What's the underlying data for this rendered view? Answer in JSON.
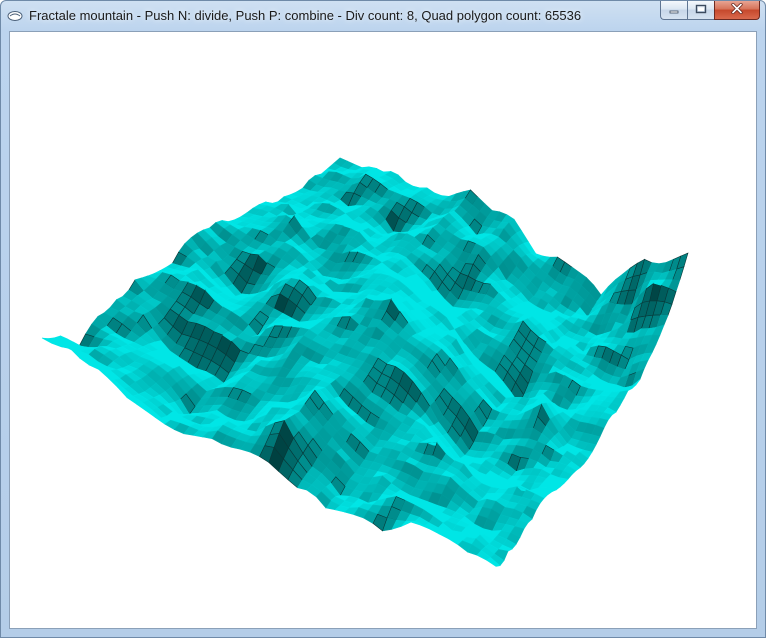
{
  "window": {
    "title": "Fractale mountain - Push N: divide, Push P: combine - Div count: 8, Quad polygon count: 65536",
    "controls": {
      "minimize_icon": "minimize-icon",
      "maximize_icon": "maximize-icon",
      "close_icon": "close-icon"
    }
  },
  "scene": {
    "surface_color": "#00e0e0",
    "shadow_color": "#0a4a4a",
    "line_color": "#083838",
    "background_color": "#ffffff"
  }
}
